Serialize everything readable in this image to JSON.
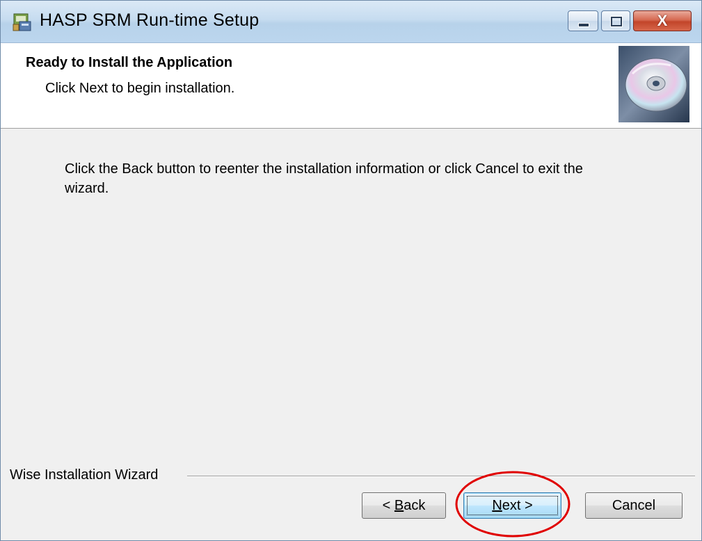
{
  "window": {
    "title": "HASP SRM Run-time Setup",
    "controls": {
      "minimize_icon": "minimize-icon",
      "maximize_icon": "maximize-icon",
      "close_glyph": "X"
    }
  },
  "header": {
    "title": "Ready to Install the Application",
    "subtitle": "Click Next to begin installation.",
    "image_icon": "cd-disc-icon"
  },
  "body": {
    "message": "Click the Back button to reenter the installation information or click Cancel to exit the wizard."
  },
  "footer": {
    "brand_label": "Wise Installation Wizard",
    "buttons": {
      "back": {
        "prefix": "< ",
        "mnemonic": "B",
        "rest": "ack"
      },
      "next": {
        "mnemonic": "N",
        "rest": "ext >"
      },
      "cancel": {
        "label": "Cancel"
      }
    }
  },
  "annotation": {
    "color": "#e00000",
    "target": "next-button"
  },
  "colors": {
    "titlebar": "#c6dcf0",
    "dialog_background": "#f0f0f0",
    "header_background": "#ffffff",
    "close_button": "#c2452a"
  }
}
